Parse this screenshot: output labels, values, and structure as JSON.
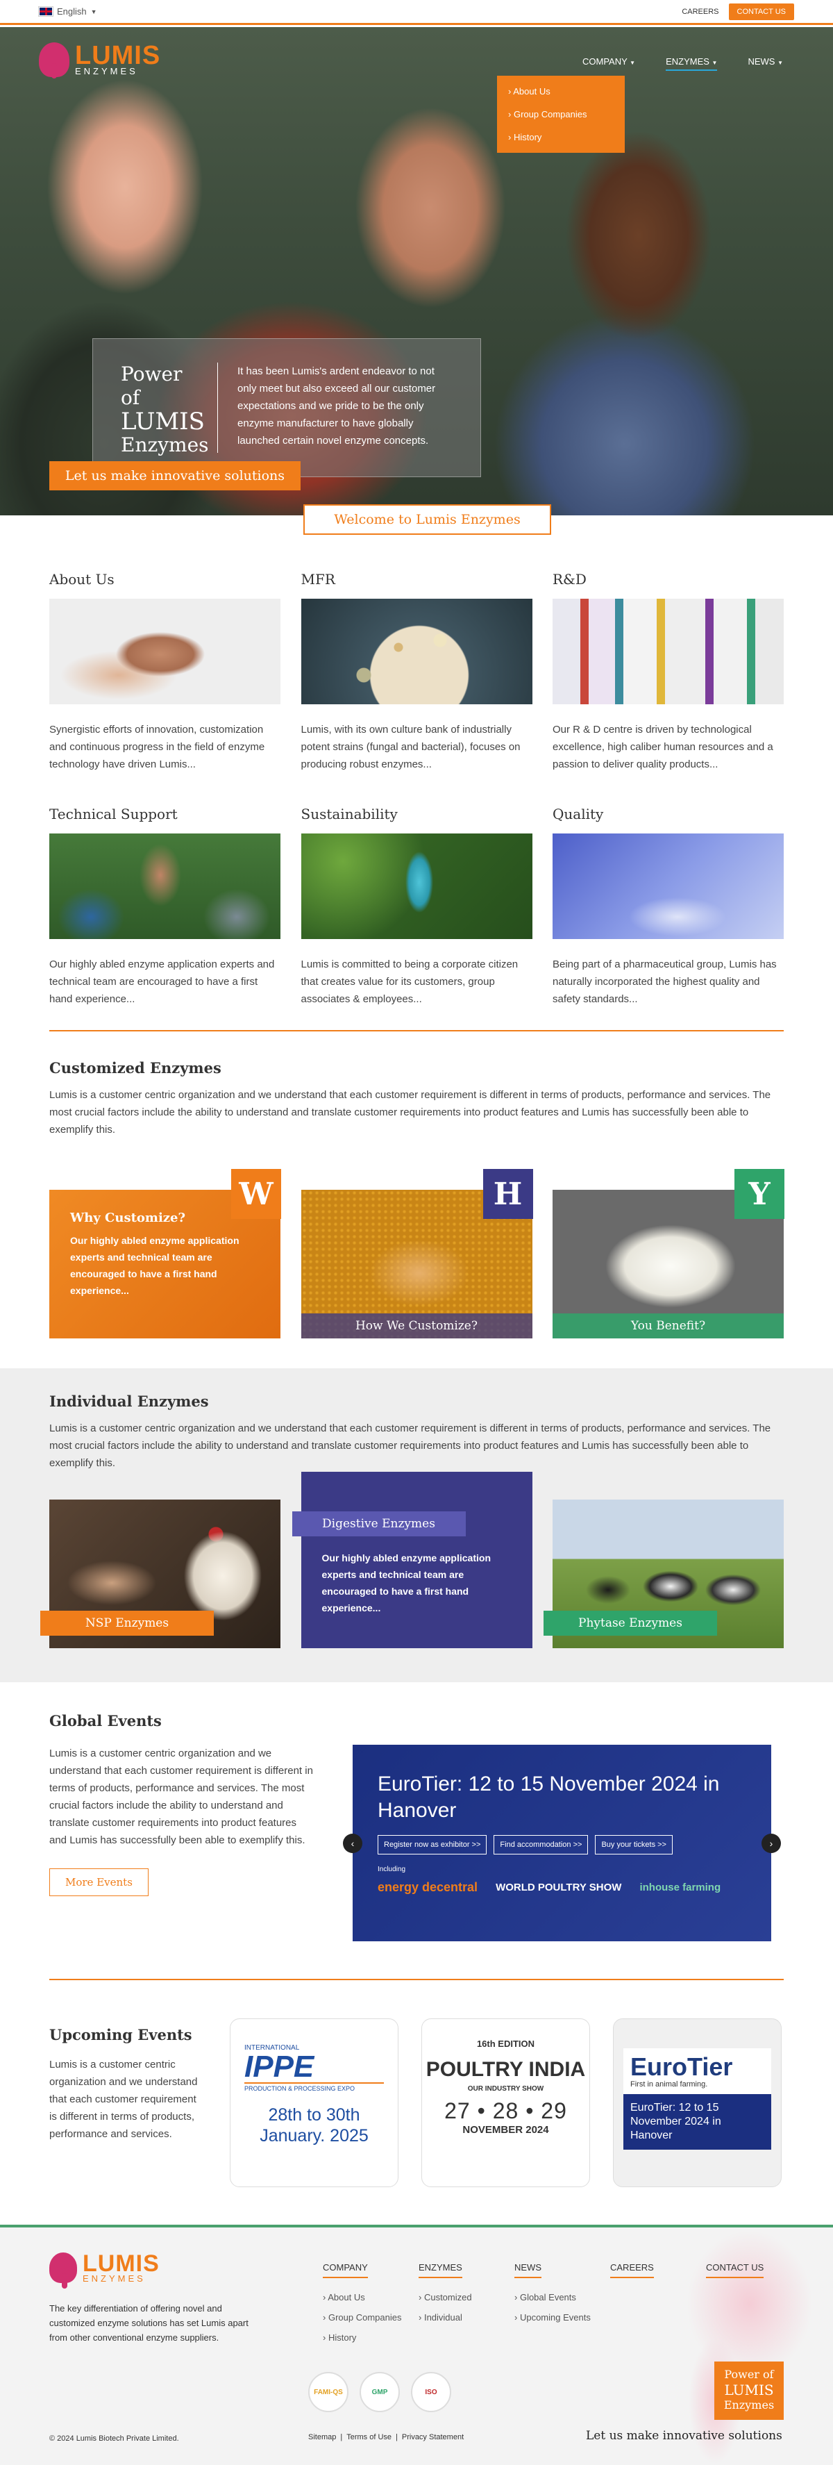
{
  "topbar": {
    "language": "English",
    "careers": "CAREERS",
    "contact": "CONTACT US"
  },
  "brand": {
    "name": "LUMIS",
    "sub": "ENZYMES"
  },
  "nav": {
    "items": [
      "COMPANY",
      "ENZYMES",
      "NEWS"
    ],
    "dropdown": [
      "About Us",
      "Group Companies",
      "History"
    ]
  },
  "hero": {
    "title_line1": "Power of",
    "title_line2": "LUMIS",
    "title_line3": "Enzymes",
    "text": "It has been Lumis's ardent endeavor to not only meet but also exceed all our customer expectations and we pride to be the only enzyme manufacturer to have globally launched certain novel enzyme concepts.",
    "cta": "Let us make innovative solutions",
    "welcome": "Welcome to Lumis Enzymes"
  },
  "about": [
    {
      "title": "About Us",
      "text": "Synergistic efforts of innovation, customization and continuous progress in the field of enzyme technology have driven Lumis..."
    },
    {
      "title": "MFR",
      "text": "Lumis, with its own culture bank of industrially potent strains (fungal and bacterial), focuses on producing robust enzymes..."
    },
    {
      "title": "R&D",
      "text": "Our R & D centre is driven by technological excellence, high caliber human resources and a passion to deliver quality products..."
    },
    {
      "title": "Technical Support",
      "text": "Our highly abled enzyme application experts and technical team are encouraged to have a first hand experience..."
    },
    {
      "title": "Sustainability",
      "text": "Lumis is committed to being a corporate citizen that creates value for its customers, group associates & employees..."
    },
    {
      "title": "Quality",
      "text": "Being part of a pharmaceutical group, Lumis has naturally incorporated the highest quality and safety standards..."
    }
  ],
  "customized": {
    "title": "Customized Enzymes",
    "text": "Lumis is a customer centric organization and we understand that each customer requirement is different in terms of products, performance and services. The most crucial factors include the ability to understand and translate customer requirements into product features and Lumis has successfully been able to exemplify this.",
    "cards": [
      {
        "letter": "W",
        "title": "Why Customize?",
        "text": "Our highly abled enzyme application experts and technical team are encouraged to have a first hand experience..."
      },
      {
        "letter": "H",
        "label": "How We Customize?"
      },
      {
        "letter": "Y",
        "label": "You Benefit?"
      }
    ]
  },
  "individual": {
    "title": "Individual Enzymes",
    "text": "Lumis is a customer centric organization and we understand that each customer requirement is different in terms of products, performance and services. The most crucial factors include the ability to understand and translate customer requirements into product features and Lumis has successfully been able to exemplify this.",
    "cards": [
      {
        "label": "NSP Enzymes"
      },
      {
        "label": "Digestive Enzymes",
        "text": "Our highly abled enzyme application experts and technical team are encouraged to have a first hand experience..."
      },
      {
        "label": "Phytase Enzymes"
      }
    ]
  },
  "global": {
    "title": "Global Events",
    "text": "Lumis is a customer centric organization and we understand that each customer requirement is different in terms of products, performance and services. The most crucial factors include the ability to understand and translate customer requirements into product features and Lumis has successfully been able to exemplify this.",
    "more": "More Events",
    "slide": {
      "title": "EuroTier: 12 to 15 November 2024 in Hanover",
      "buttons": [
        "Register now as exhibitor >>",
        "Find accommodation >>",
        "Buy your tickets >>"
      ],
      "including": "Including",
      "logos": [
        "energy decentral",
        "WORLD POULTRY SHOW",
        "inhouse farming"
      ]
    }
  },
  "upcoming": {
    "title": "Upcoming Events",
    "text": "Lumis is a customer centric organization and we understand that each customer requirement is different in terms of products, performance and services.",
    "cards": [
      {
        "logo": "IPPE",
        "logo_sub": "INTERNATIONAL",
        "logo_sub2": "PRODUCTION & PROCESSING EXPO",
        "date": "28th to 30th January. 2025"
      },
      {
        "badge": "16th EDITION",
        "logo": "POULTRY INDIA",
        "logo_sub": "OUR INDUSTRY SHOW",
        "date": "27 • 28 • 29",
        "month": "NOVEMBER 2024"
      },
      {
        "logo": "EuroTier",
        "logo_sub": "First in animal farming.",
        "date": "EuroTier: 12 to 15 November 2024 in Hanover"
      }
    ]
  },
  "footer": {
    "about": "The key differentiation of offering novel and customized enzyme solutions has set Lumis apart from other conventional enzyme suppliers.",
    "columns": [
      {
        "title": "COMPANY",
        "items": [
          "About Us",
          "Group Companies",
          "History"
        ]
      },
      {
        "title": "ENZYMES",
        "items": [
          "Customized",
          "Individual"
        ]
      },
      {
        "title": "NEWS",
        "items": [
          "Global Events",
          "Upcoming Events"
        ]
      },
      {
        "title": "CAREERS",
        "items": []
      },
      {
        "title": "CONTACT US",
        "items": []
      }
    ],
    "badges": [
      "FAMI-QS",
      "GMP",
      "ISO"
    ],
    "copyright": "© 2024 Lumis Biotech Private Limited.",
    "links": [
      "Sitemap",
      "Terms of Use",
      "Privacy Statement"
    ],
    "power_line1": "Power of",
    "power_line2": "LUMIS",
    "power_line3": "Enzymes",
    "tagline": "Let us make innovative solutions"
  },
  "colors": {
    "accent": "#f07d1a",
    "purple": "#3b3a86",
    "green": "#2fa46a",
    "navy": "#1b2f80"
  }
}
